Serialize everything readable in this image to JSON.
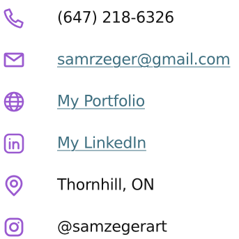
{
  "accent_color": "#9a5ad0",
  "link_color": "#3e6f80",
  "contacts": [
    {
      "icon": "phone-icon",
      "label": "(647) 218-6326",
      "link": false
    },
    {
      "icon": "mail-icon",
      "label": "samrzeger@gmail.com",
      "link": true
    },
    {
      "icon": "globe-icon",
      "label": "My Portfolio",
      "link": true
    },
    {
      "icon": "linkedin-icon",
      "label": "My LinkedIn",
      "link": true
    },
    {
      "icon": "location-pin-icon",
      "label": "Thornhill, ON",
      "link": false
    },
    {
      "icon": "instagram-icon",
      "label": "@samzegerart",
      "link": false
    }
  ]
}
